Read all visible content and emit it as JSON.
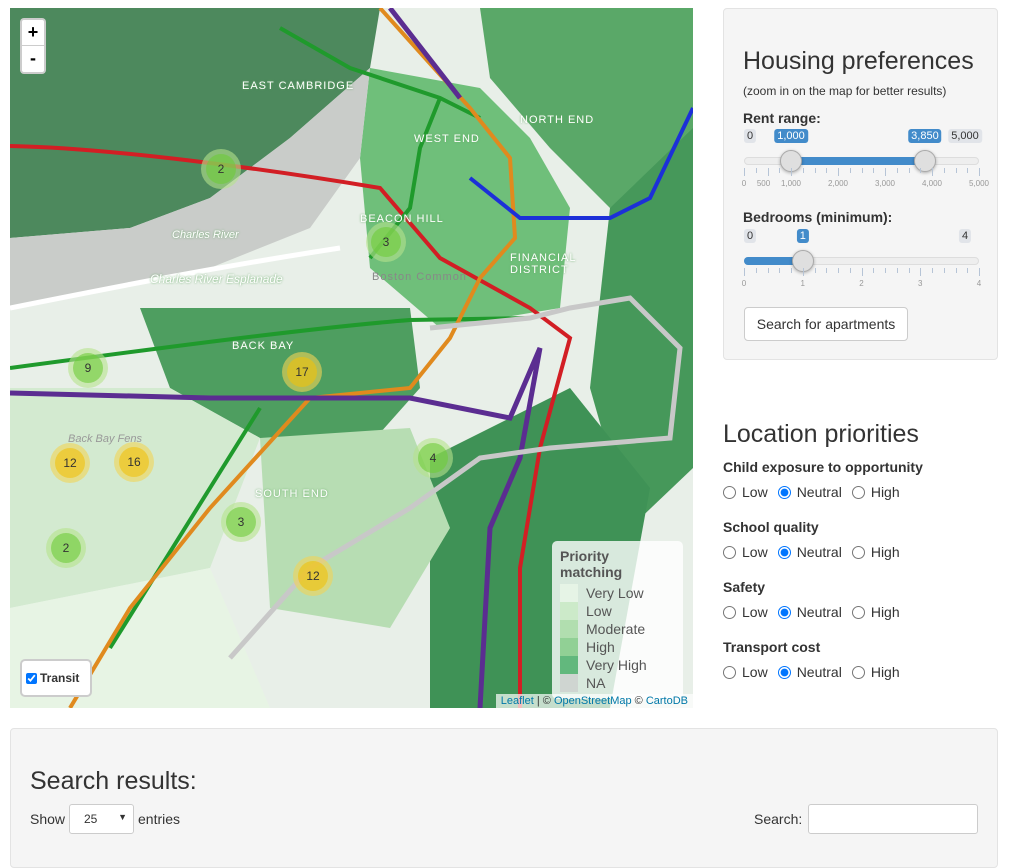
{
  "map": {
    "zoom_in": "+",
    "zoom_out": "-",
    "labels": [
      "EAST CAMBRIDGE",
      "WEST END",
      "NORTH END",
      "BEACON HILL",
      "Boston Common",
      "FINANCIAL DISTRICT",
      "BACK BAY",
      "SOUTH END",
      "Charles River",
      "Charles River Esplanade",
      "Back Bay Fens"
    ],
    "clusters": [
      {
        "count": "2",
        "level": "green"
      },
      {
        "count": "3",
        "level": "green"
      },
      {
        "count": "9",
        "level": "green"
      },
      {
        "count": "17",
        "level": "yellow"
      },
      {
        "count": "12",
        "level": "yellow"
      },
      {
        "count": "16",
        "level": "yellow"
      },
      {
        "count": "4",
        "level": "green"
      },
      {
        "count": "3",
        "level": "green"
      },
      {
        "count": "2",
        "level": "green"
      },
      {
        "count": "12",
        "level": "yellow"
      }
    ],
    "legend": {
      "title": "Priority matching",
      "items": [
        {
          "label": "Very Low",
          "color": "#edf8e9"
        },
        {
          "label": "Low",
          "color": "#c7e9c0"
        },
        {
          "label": "Moderate",
          "color": "#a1d99b"
        },
        {
          "label": "High",
          "color": "#74c476"
        },
        {
          "label": "Very High",
          "color": "#31a354"
        },
        {
          "label": "NA",
          "color": "#cccccc"
        }
      ]
    },
    "transit_toggle": {
      "label": "Transit",
      "checked": true
    },
    "attribution": {
      "leaflet": "Leaflet",
      "sep": " | © ",
      "osm": "OpenStreetMap",
      "sep2": " © ",
      "carto": "CartoDB"
    },
    "line_colors": {
      "red": "#d21e24",
      "green": "#1f9a2c",
      "orange": "#e08a1e",
      "blue": "#1c30d8",
      "silver": "#c8c8c8",
      "purple": "#5b2d91"
    }
  },
  "housing": {
    "title": "Housing preferences",
    "subtitle": "(zoom in on the map for better results)",
    "rent": {
      "label": "Rent range:",
      "min": 0,
      "max": 5000,
      "from": 1000,
      "to": 3850,
      "min_label": "0",
      "max_label": "5,000",
      "from_label": "1,000",
      "to_label": "3,850",
      "ticks": [
        "0",
        "500",
        "1,000",
        "2,000",
        "3,000",
        "4,000",
        "5,000"
      ]
    },
    "bedrooms": {
      "label": "Bedrooms (minimum):",
      "min": 0,
      "max": 4,
      "value": 1,
      "min_label": "0",
      "max_label": "4",
      "value_label": "1",
      "ticks": [
        "0",
        "1",
        "2",
        "3",
        "4"
      ]
    },
    "search_button": "Search for apartments"
  },
  "location": {
    "title": "Location priorities",
    "options": [
      "Low",
      "Neutral",
      "High"
    ],
    "priorities": [
      {
        "label": "Child exposure to opportunity",
        "selected": "Neutral"
      },
      {
        "label": "School quality",
        "selected": "Neutral"
      },
      {
        "label": "Safety",
        "selected": "Neutral"
      },
      {
        "label": "Transport cost",
        "selected": "Neutral"
      }
    ]
  },
  "results": {
    "title": "Search results:",
    "show_label": "Show",
    "entries_value": "25",
    "entries_label": "entries",
    "search_label": "Search:",
    "search_value": ""
  }
}
